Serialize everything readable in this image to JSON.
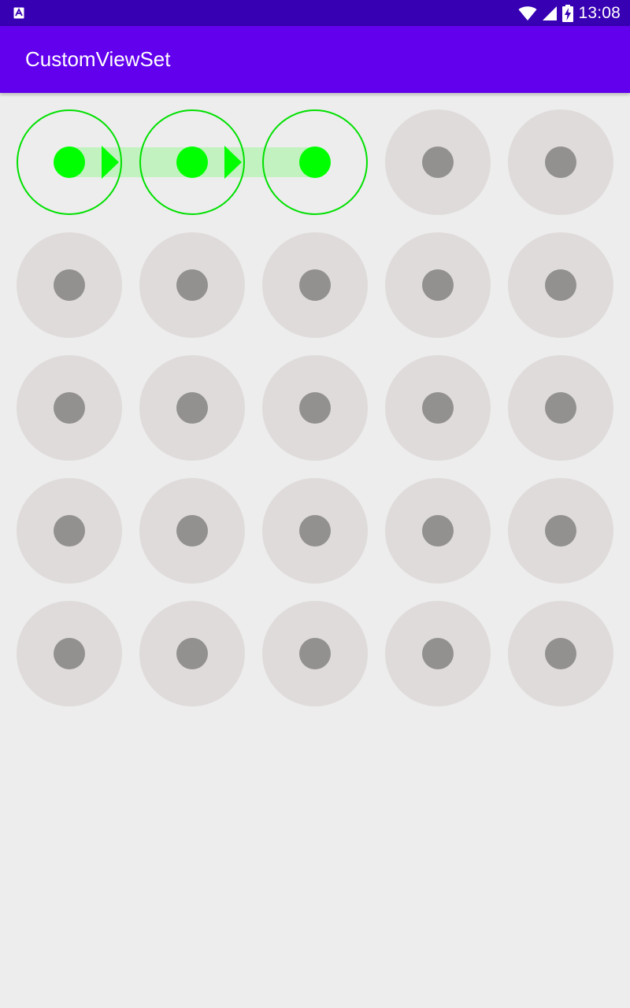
{
  "status_bar": {
    "time": "13:08",
    "app_icon": "a-letter-notification-icon",
    "icons": [
      "wifi-icon",
      "cell-signal-icon",
      "battery-charging-icon"
    ],
    "background": "#3700b3"
  },
  "app_bar": {
    "title": "CustomViewSet",
    "background": "#6200ee"
  },
  "pattern_lock": {
    "rows": 5,
    "cols": 5,
    "selected_path": [
      {
        "row": 0,
        "col": 0
      },
      {
        "row": 0,
        "col": 1
      },
      {
        "row": 0,
        "col": 2
      }
    ],
    "colors": {
      "background": "#ededed",
      "node_idle_outer": "#dfdbda",
      "node_idle_inner": "#929190",
      "node_selected_ring": "#00e000",
      "node_selected_inner": "#00ff00",
      "path_line": "#c2f2c0",
      "arrow": "#00ff00"
    }
  }
}
